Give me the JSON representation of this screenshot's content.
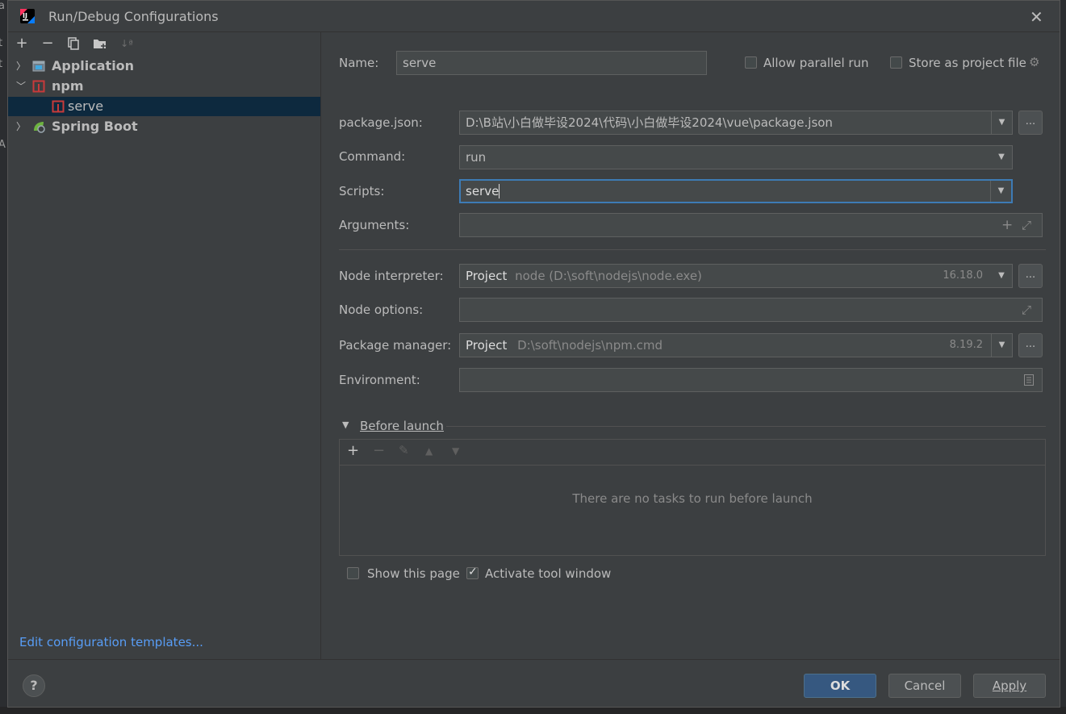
{
  "window": {
    "title": "Run/Debug Configurations"
  },
  "toolbar": {
    "sort": "↓ª"
  },
  "tree": [
    {
      "label": "Application"
    },
    {
      "label": "npm"
    },
    {
      "label": "serve"
    },
    {
      "label": "Spring Boot"
    }
  ],
  "edit_templates": "Edit configuration templates...",
  "form": {
    "name_label": "Name:",
    "name_value": "serve",
    "allow_parallel": "Allow parallel run",
    "store_project": "Store as project file",
    "package_json_label": "package.json:",
    "package_json_value": "D:\\B站\\小白做毕设2024\\代码\\小白做毕设2024\\vue\\package.json",
    "command_label": "Command:",
    "command_value": "run",
    "scripts_label": "Scripts:",
    "scripts_value": "serve",
    "arguments_label": "Arguments:",
    "node_interp_label": "Node interpreter:",
    "node_interp_prefix": "Project",
    "node_interp_path": "node (D:\\soft\\nodejs\\node.exe)",
    "node_interp_version": "16.18.0",
    "node_options_label": "Node options:",
    "pkg_mgr_label": "Package manager:",
    "pkg_mgr_prefix": "Project",
    "pkg_mgr_path": "D:\\soft\\nodejs\\npm.cmd",
    "pkg_mgr_version": "8.19.2",
    "environment_label": "Environment:",
    "dots": "..."
  },
  "before_launch": {
    "title": "Before launch",
    "empty": "There are no tasks to run before launch"
  },
  "options": {
    "show_page": "Show this page",
    "activate_tool": "Activate tool window"
  },
  "buttons": {
    "help": "?",
    "ok": "OK",
    "cancel": "Cancel",
    "apply": "Apply"
  },
  "colors": {
    "accent": "#365880",
    "link": "#589df6",
    "selection": "#0d293e",
    "focus": "#3d7bb5"
  }
}
